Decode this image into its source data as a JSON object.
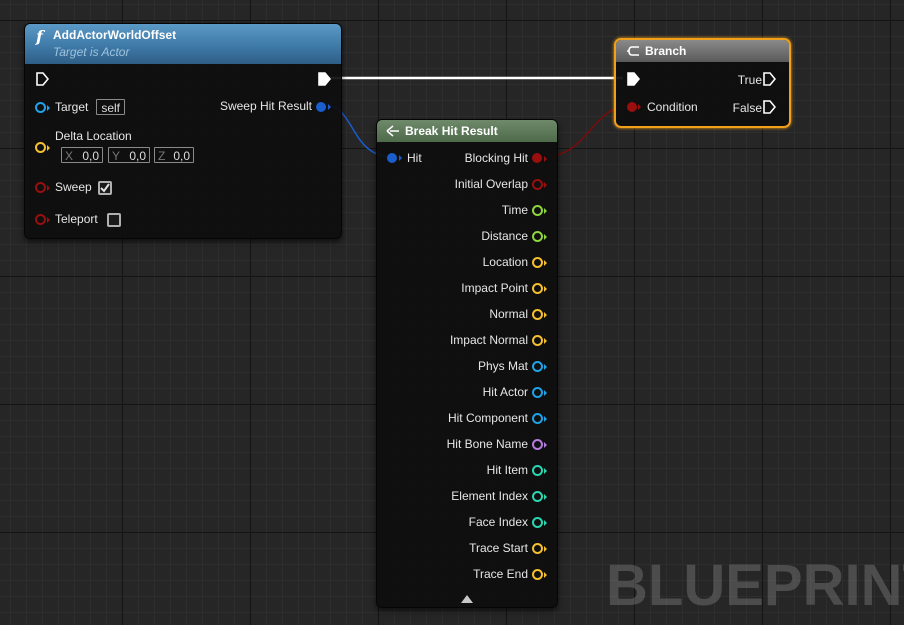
{
  "colors": {
    "function_header": "#4b86b4",
    "break_header": "#5a7556",
    "branch_header": "#6a6a6a",
    "selected_outline": "#f2a01a",
    "object_pin": "#1fa3e8",
    "struct_pin": "#1a5dcc",
    "vector_pin": "#f5c030",
    "bool_pin": "#9a0e0e",
    "float_pin": "#8fd63e",
    "name_pin": "#b57ce0",
    "int_pin": "#2ad7b0"
  },
  "add_actor_node": {
    "title": "AddActorWorldOffset",
    "subtitle": "Target is Actor",
    "target_label": "Target",
    "target_value": "self",
    "delta_label": "Delta Location",
    "x_axis": "X",
    "x_value": "0,0",
    "y_axis": "Y",
    "y_value": "0,0",
    "z_axis": "Z",
    "z_value": "0,0",
    "sweep_label": "Sweep",
    "sweep_checked": true,
    "teleport_label": "Teleport",
    "teleport_checked": false,
    "sweep_hit_result_label": "Sweep Hit Result"
  },
  "break_hit_node": {
    "title": "Break Hit Result",
    "input_label": "Hit",
    "outputs": [
      {
        "label": "Blocking Hit",
        "type": "bool"
      },
      {
        "label": "Initial Overlap",
        "type": "bool"
      },
      {
        "label": "Time",
        "type": "float"
      },
      {
        "label": "Distance",
        "type": "float"
      },
      {
        "label": "Location",
        "type": "vector"
      },
      {
        "label": "Impact Point",
        "type": "vector"
      },
      {
        "label": "Normal",
        "type": "vector"
      },
      {
        "label": "Impact Normal",
        "type": "vector"
      },
      {
        "label": "Phys Mat",
        "type": "object"
      },
      {
        "label": "Hit Actor",
        "type": "object"
      },
      {
        "label": "Hit Component",
        "type": "object"
      },
      {
        "label": "Hit Bone Name",
        "type": "name"
      },
      {
        "label": "Hit Item",
        "type": "int"
      },
      {
        "label": "Element Index",
        "type": "int"
      },
      {
        "label": "Face Index",
        "type": "int"
      },
      {
        "label": "Trace Start",
        "type": "vector"
      },
      {
        "label": "Trace End",
        "type": "vector"
      }
    ],
    "collapse_icon": "triangle-up-icon"
  },
  "branch_node": {
    "title": "Branch",
    "condition_label": "Condition",
    "true_label": "True",
    "false_label": "False"
  },
  "watermark": "BLUEPRINT"
}
